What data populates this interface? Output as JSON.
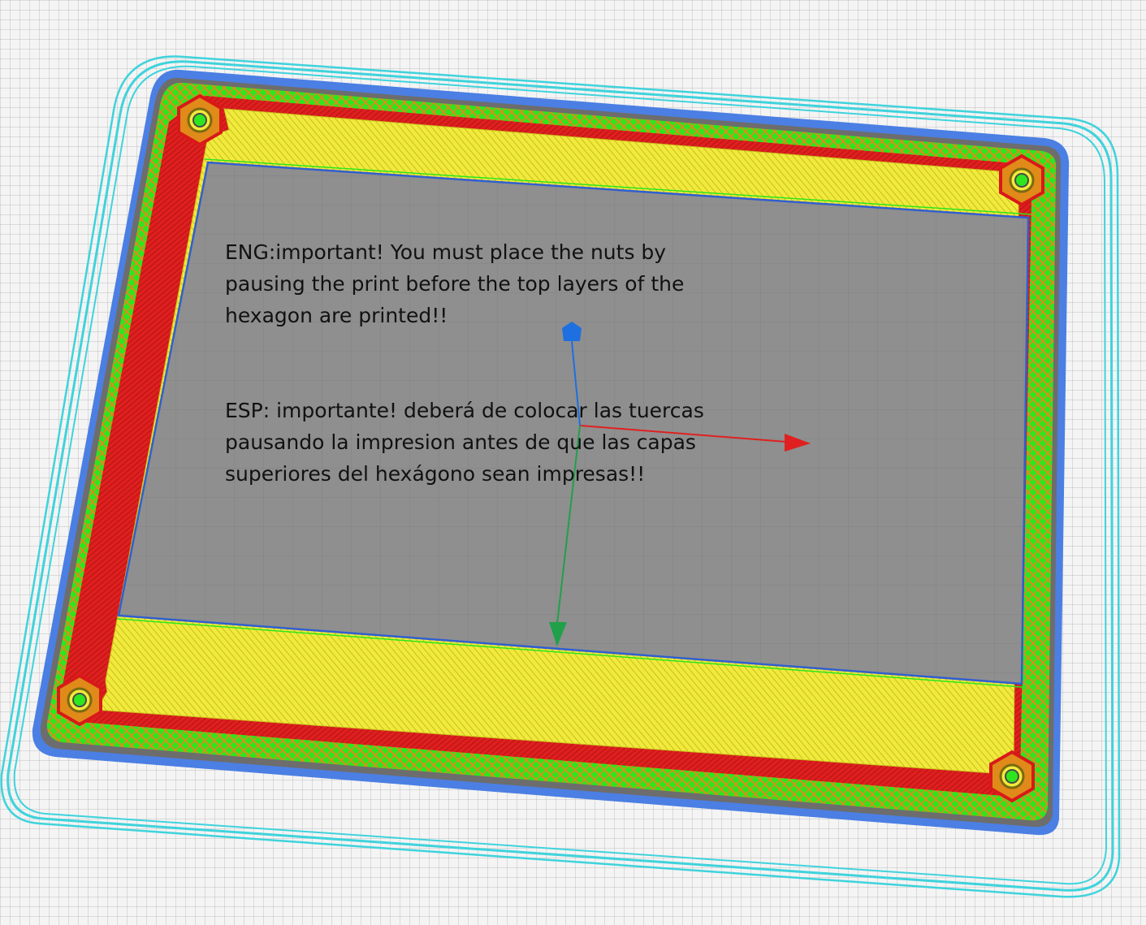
{
  "notes": {
    "english": {
      "lines": [
        "ENG:important! You must place the nuts by",
        "pausing the print before the top layers of the",
        "hexagon are printed!!"
      ]
    },
    "spanish": {
      "lines": [
        "ESP: importante! deberá de colocar las tuercas",
        "pausando la impresion antes de que las capas",
        "superiores del hexágono sean impresas!!"
      ]
    }
  },
  "legend_colors": {
    "skirt": "#3fd3dc",
    "outer_wall": "#d91919",
    "inner_wall": "#2ee61d",
    "infill": "#e08a1a",
    "top_bottom": "#f2ea3a",
    "support_interface": "#4b7fe3",
    "model_top": "#8f8f8f"
  },
  "icons": {
    "axis_x": "x-axis-arrow-icon",
    "axis_y": "y-axis-arrow-icon",
    "axis_z": "z-axis-handle-icon",
    "nut": "hex-nut-icon"
  }
}
